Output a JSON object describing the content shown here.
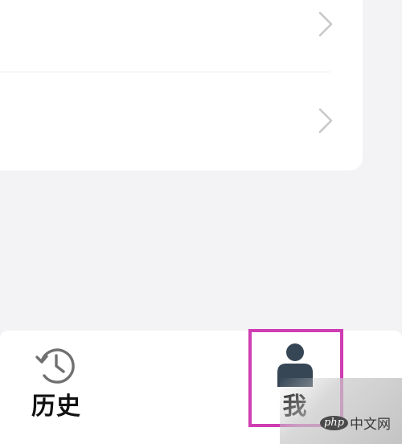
{
  "list": {
    "rows": [
      {
        "chevron_icon": "chevron-right-icon"
      },
      {
        "chevron_icon": "chevron-right-icon"
      }
    ]
  },
  "tab_bar": {
    "tabs": [
      {
        "label": "历史",
        "icon": "history-icon"
      },
      {
        "label": "我",
        "icon": "person-icon",
        "highlighted": true
      }
    ]
  },
  "highlight": {
    "color": "#cf3db2"
  },
  "watermark": {
    "badge": "php",
    "text": "中文网"
  },
  "colors": {
    "background": "#f3f2f4",
    "card": "#ffffff",
    "chevron": "#c8c8cc",
    "icon_dark": "#364655",
    "label": "#111111"
  }
}
